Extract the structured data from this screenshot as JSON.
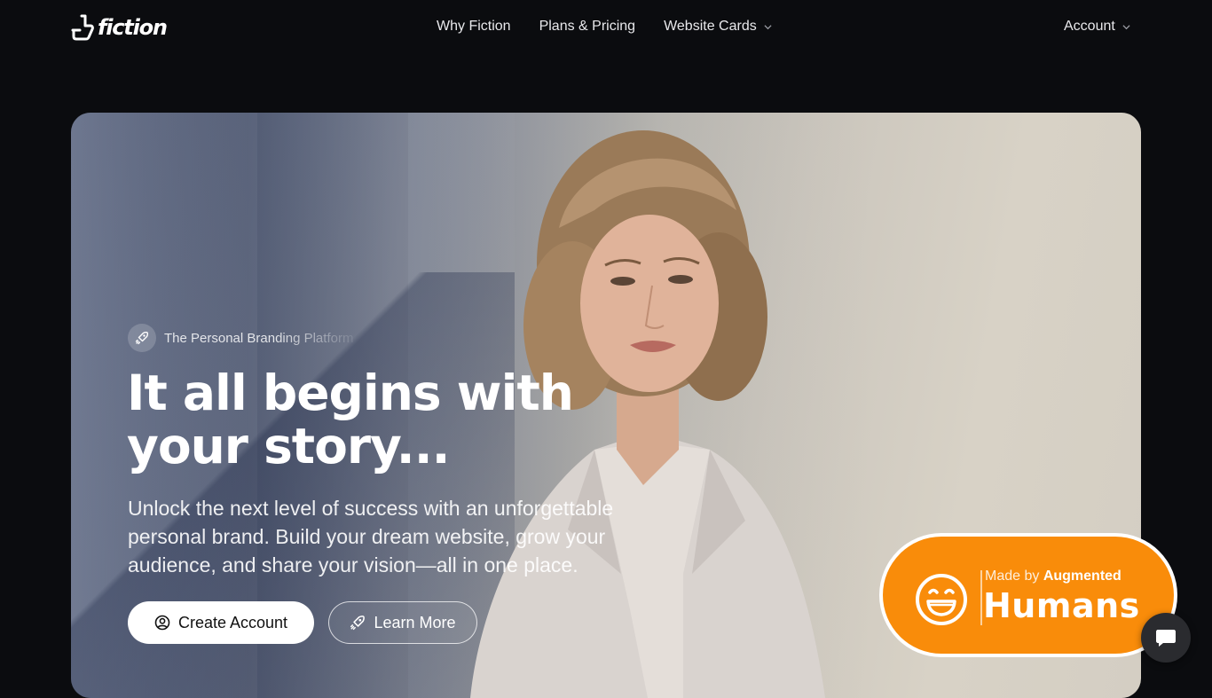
{
  "brand": {
    "name": "fiction"
  },
  "nav": {
    "items": [
      {
        "label": "Why Fiction"
      },
      {
        "label": "Plans & Pricing"
      },
      {
        "label": "Website Cards"
      }
    ],
    "account_label": "Account"
  },
  "hero": {
    "badge_text": "The Personal Branding Platform",
    "headline_line1": "It all begins with",
    "headline_line2": "your story...",
    "subtext": "Unlock the next level of success with an unforgettable personal brand. Build your dream website, grow your audience, and share your vision—all in one place.",
    "primary_button": "Create Account",
    "secondary_button": "Learn More"
  },
  "made_by": {
    "prefix": "Made by",
    "strong": "Augmented",
    "big": "Humans"
  },
  "colors": {
    "background": "#0b0c0f",
    "badge_orange": "#f98c0a",
    "primary_button_bg": "#ffffff"
  },
  "icons": [
    "fiction-logo-icon",
    "chevron-down-icon",
    "rocket-icon",
    "user-circle-icon",
    "smiley-icon",
    "chat-icon"
  ]
}
